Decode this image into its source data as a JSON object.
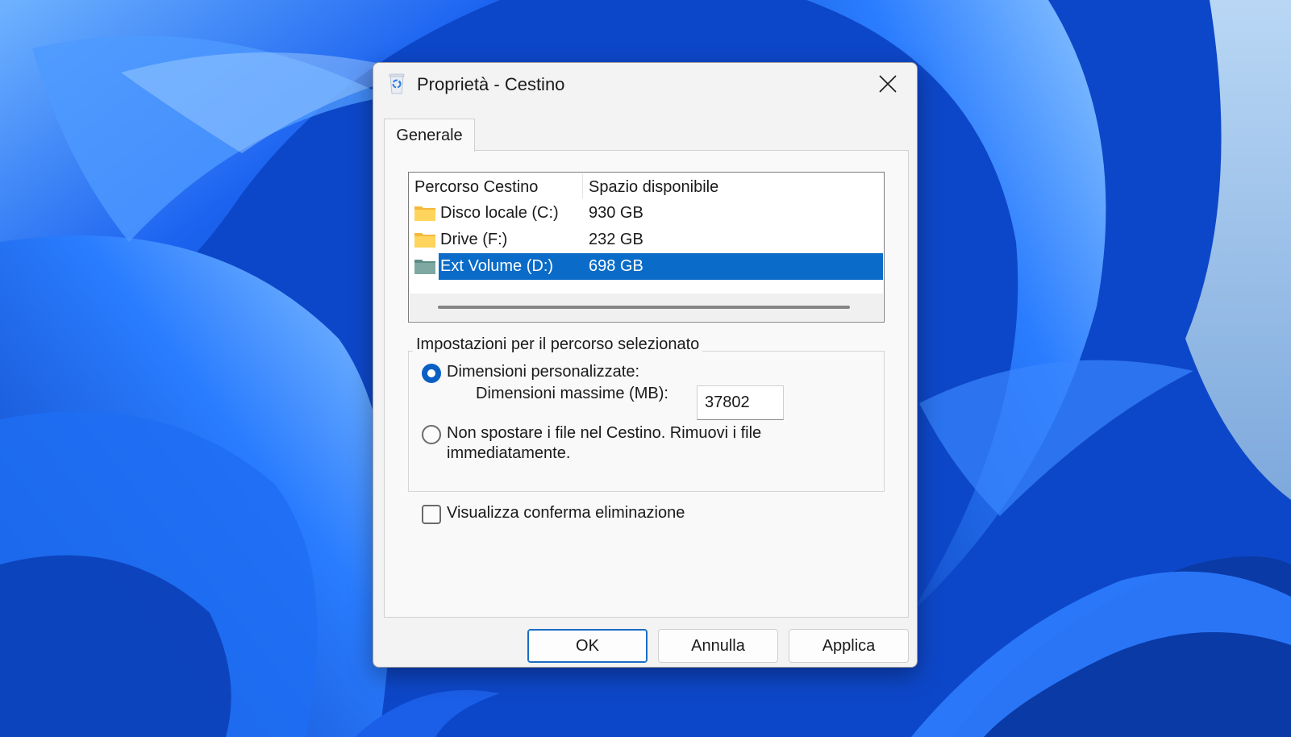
{
  "colors": {
    "accent": "#0a6cc8",
    "dialog_bg": "#f3f3f3",
    "wallpaper": "#1556e0"
  },
  "window": {
    "title": "Proprietà - Cestino",
    "icon": "recycle-bin-icon"
  },
  "tabs": [
    {
      "label": "Generale",
      "active": true
    }
  ],
  "location_list": {
    "columns": [
      "Percorso Cestino",
      "Spazio disponibile"
    ],
    "rows": [
      {
        "name": "Disco locale (C:)",
        "free": "930 GB",
        "icon": "folder-icon",
        "selected": false
      },
      {
        "name": "Drive (F:)",
        "free": "232 GB",
        "icon": "folder-icon",
        "selected": false
      },
      {
        "name": "Ext Volume (D:)",
        "free": "698 GB",
        "icon": "drive-folder-icon",
        "selected": true
      }
    ]
  },
  "settings": {
    "group_title": "Impostazioni per il percorso selezionato",
    "custom_size_label": "Dimensioni personalizzate:",
    "custom_size_selected": true,
    "max_size_label": "Dimensioni massime (MB):",
    "max_size_value": "37802",
    "no_recycle_label_line1": "Non spostare i file nel Cestino. Rimuovi i file",
    "no_recycle_label_line2": "immediatamente.",
    "no_recycle_selected": false,
    "confirm_delete_label": "Visualizza conferma eliminazione",
    "confirm_delete_checked": false
  },
  "buttons": {
    "ok": "OK",
    "cancel": "Annulla",
    "apply": "Applica"
  }
}
